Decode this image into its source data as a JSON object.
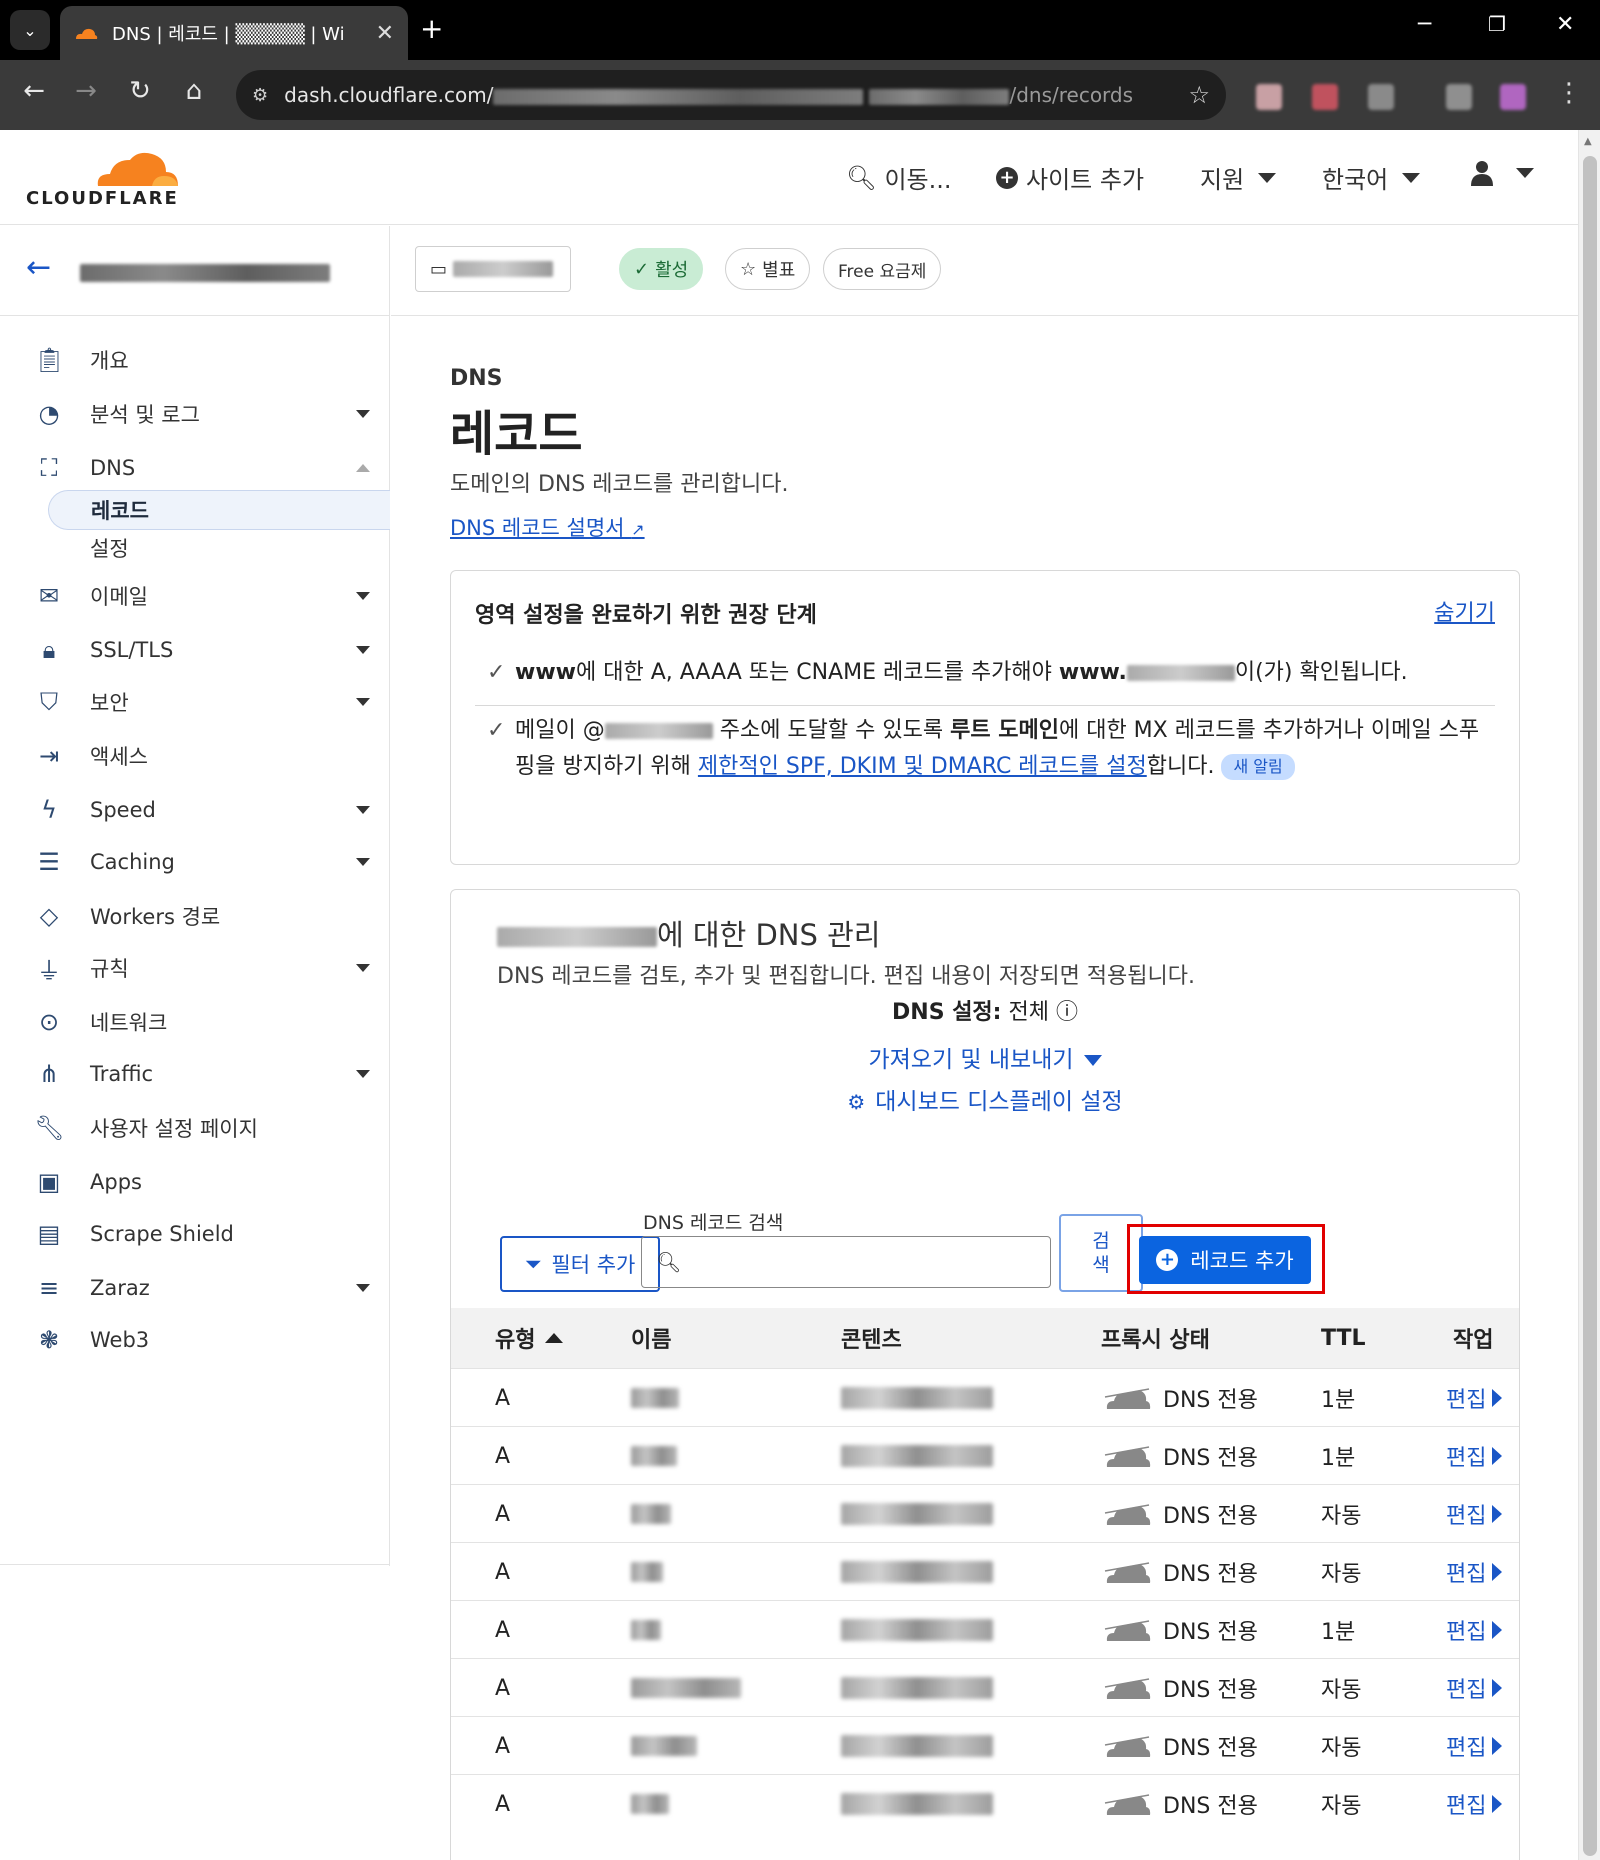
{
  "browser": {
    "tab_title": "DNS | 레코드 | ▒▒▒▒▒ | Wi",
    "url_prefix": "dash.cloudflare.com/",
    "url_suffix": "/dns/records"
  },
  "header": {
    "logo_text": "CLOUDFLARE",
    "goto_label": "이동...",
    "add_site_label": "사이트 추가",
    "support_label": "지원",
    "language_label": "한국어"
  },
  "sidebar": {
    "items": [
      {
        "icon": "clipboard-icon",
        "label": "개요"
      },
      {
        "icon": "pie-chart-icon",
        "label": "분석 및 로그"
      },
      {
        "icon": "network-icon",
        "label": "DNS"
      },
      {
        "icon": "mail-icon",
        "label": "이메일"
      },
      {
        "icon": "lock-icon",
        "label": "SSL/TLS"
      },
      {
        "icon": "shield-icon",
        "label": "보안"
      },
      {
        "icon": "access-icon",
        "label": "액세스"
      },
      {
        "icon": "bolt-icon",
        "label": "Speed"
      },
      {
        "icon": "server-icon",
        "label": "Caching"
      },
      {
        "icon": "workers-icon",
        "label": "Workers 경로"
      },
      {
        "icon": "funnel-icon",
        "label": "규칙"
      },
      {
        "icon": "location-icon",
        "label": "네트워크"
      },
      {
        "icon": "traffic-icon",
        "label": "Traffic"
      },
      {
        "icon": "wrench-icon",
        "label": "사용자 설정 페이지"
      },
      {
        "icon": "apps-icon",
        "label": "Apps"
      },
      {
        "icon": "document-icon",
        "label": "Scrape Shield"
      },
      {
        "icon": "zaraz-icon",
        "label": "Zaraz"
      },
      {
        "icon": "web3-icon",
        "label": "Web3"
      }
    ],
    "dns_sub": [
      "레코드",
      "설정"
    ]
  },
  "zone_bar": {
    "active_label": "활성",
    "star_label": "별표",
    "plan_label": "Free 요금제"
  },
  "main": {
    "section_label": "DNS",
    "title": "레코드",
    "description": "도메인의 DNS 레코드를 관리합니다.",
    "doc_link": "DNS 레코드 설명서",
    "recommend": {
      "title": "영역 설정을 완료하기 위한 권장 단계",
      "hide": "숨기기",
      "item1_a": "www",
      "item1_b": "에 대한 A, AAAA 또는 CNAME 레코드를 추가해야 ",
      "item1_c": "www.",
      "item1_d": "이(가) 확인됩니다.",
      "item2_a": "메일이 @",
      "item2_b": " 주소에 도달할 수 있도록 ",
      "item2_c": "루트 도메인",
      "item2_d": "에 대한 MX 레코드를 추가하거나 이메일 스푸핑을 방지하기 위해 ",
      "item2_link": "제한적인 SPF, DKIM 및 DMARC 레코드를 설정",
      "item2_e": "합니다.",
      "badge": "새 알림"
    },
    "mgmt": {
      "title_suffix": "에 대한 DNS 관리",
      "description": "DNS 레코드를 검토, 추가 및 편집합니다. 편집 내용이 저장되면 적용됩니다.",
      "setting_label": "DNS 설정:",
      "setting_value": "전체",
      "import_export": "가져오기 및 내보내기",
      "display_settings": "대시보드 디스플레이 설정",
      "filter_btn": "필터 추가",
      "search_label": "DNS 레코드 검색",
      "search_btn": "검색",
      "add_record": "레코드 추가"
    },
    "table": {
      "headers": {
        "type": "유형",
        "name": "이름",
        "content": "콘텐츠",
        "proxy": "프록시 상태",
        "ttl": "TTL",
        "action": "작업"
      },
      "rows": [
        {
          "type": "A",
          "proxy": "DNS 전용",
          "ttl": "1분",
          "action": "편집"
        },
        {
          "type": "A",
          "proxy": "DNS 전용",
          "ttl": "1분",
          "action": "편집"
        },
        {
          "type": "A",
          "proxy": "DNS 전용",
          "ttl": "자동",
          "action": "편집"
        },
        {
          "type": "A",
          "proxy": "DNS 전용",
          "ttl": "자동",
          "action": "편집"
        },
        {
          "type": "A",
          "proxy": "DNS 전용",
          "ttl": "1분",
          "action": "편집"
        },
        {
          "type": "A",
          "proxy": "DNS 전용",
          "ttl": "자동",
          "action": "편집"
        },
        {
          "type": "A",
          "proxy": "DNS 전용",
          "ttl": "자동",
          "action": "편집"
        },
        {
          "type": "A",
          "proxy": "DNS 전용",
          "ttl": "자동",
          "action": "편집"
        }
      ]
    }
  },
  "colors": {
    "accent": "#1a56c6",
    "primary_button": "#0b64e0",
    "highlight": "#e10000",
    "cf_orange": "#f6821f"
  }
}
